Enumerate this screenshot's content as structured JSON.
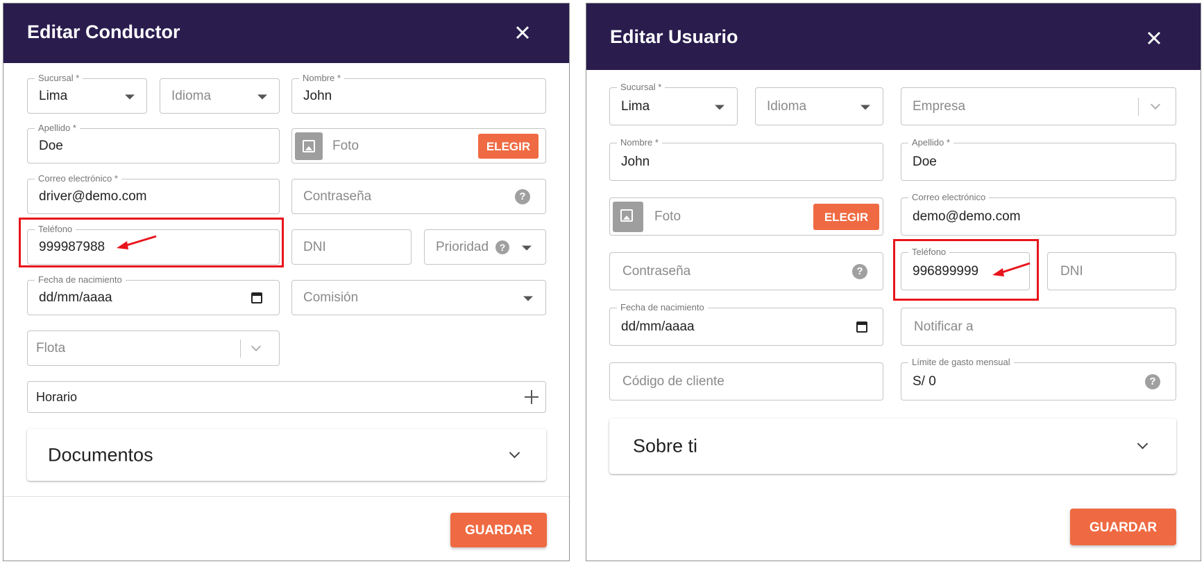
{
  "left_modal": {
    "title": "Editar Conductor",
    "branch": {
      "label": "Sucursal *",
      "value": "Lima"
    },
    "language": {
      "placeholder": "Idioma"
    },
    "first_name": {
      "label": "Nombre *",
      "value": "John"
    },
    "last_name": {
      "label": "Apellido *",
      "value": "Doe"
    },
    "photo": {
      "placeholder": "Foto",
      "button_label": "ELEGIR"
    },
    "email": {
      "label": "Correo electrónico *",
      "value": "driver@demo.com"
    },
    "password": {
      "placeholder": "Contraseña"
    },
    "phone": {
      "label": "Teléfono",
      "value": "999987988"
    },
    "dni": {
      "placeholder": "DNI"
    },
    "priority": {
      "placeholder": "Prioridad"
    },
    "birth_date": {
      "label": "Fecha de nacimiento",
      "value": "dd/mm/aaaa"
    },
    "commission": {
      "placeholder": "Comisión"
    },
    "fleet": {
      "placeholder": "Flota"
    },
    "schedule": {
      "label": "Horario"
    },
    "documents": {
      "title": "Documentos"
    },
    "save_label": "GUARDAR"
  },
  "right_modal": {
    "title": "Editar Usuario",
    "branch": {
      "label": "Sucursal *",
      "value": "Lima"
    },
    "language": {
      "placeholder": "Idioma"
    },
    "company": {
      "placeholder": "Empresa"
    },
    "first_name": {
      "label": "Nombre *",
      "value": "John"
    },
    "last_name": {
      "label": "Apellido *",
      "value": "Doe"
    },
    "photo": {
      "placeholder": "Foto",
      "button_label": "ELEGIR"
    },
    "email": {
      "label": "Correo electrónico",
      "value": "demo@demo.com"
    },
    "password": {
      "placeholder": "Contraseña"
    },
    "phone": {
      "label": "Teléfono",
      "value": "996899999"
    },
    "dni": {
      "placeholder": "DNI"
    },
    "birth_date": {
      "label": "Fecha de nacimiento",
      "value": "dd/mm/aaaa"
    },
    "notify": {
      "placeholder": "Notificar a"
    },
    "client_code": {
      "placeholder": "Código de cliente"
    },
    "spending_limit": {
      "label": "Límite de gasto mensual",
      "value": "S/ 0"
    },
    "about": {
      "title": "Sobre ti"
    },
    "save_label": "GUARDAR"
  },
  "colors": {
    "header": "#2a1d4e",
    "accent": "#ef6a42",
    "highlight": "#e8141b"
  }
}
